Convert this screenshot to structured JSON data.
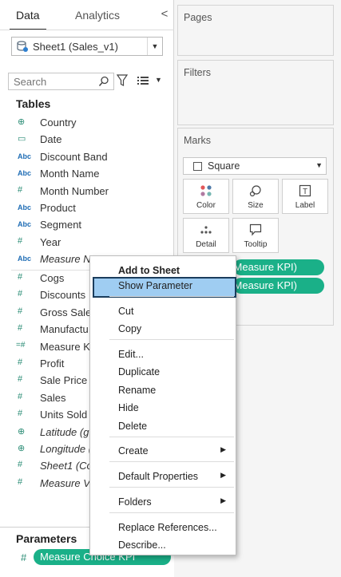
{
  "data_pane": {
    "tabs": [
      "Data",
      "Analytics"
    ],
    "collapse_glyph": "<",
    "datasource": {
      "label": "Sheet1 (Sales_v1)",
      "icon": "database-icon"
    },
    "search": {
      "placeholder": "Search"
    },
    "tables_header": "Tables",
    "dimensions": [
      {
        "name": "Country",
        "type": "geo",
        "italic": false
      },
      {
        "name": "Date",
        "type": "date",
        "italic": false
      },
      {
        "name": "Discount Band",
        "type": "abc",
        "italic": false
      },
      {
        "name": "Month Name",
        "type": "abc",
        "italic": false
      },
      {
        "name": "Month Number",
        "type": "number",
        "italic": false
      },
      {
        "name": "Product",
        "type": "abc",
        "italic": false
      },
      {
        "name": "Segment",
        "type": "abc",
        "italic": false
      },
      {
        "name": "Year",
        "type": "number",
        "italic": false
      },
      {
        "name": "Measure N",
        "type": "abc",
        "italic": true
      }
    ],
    "measures": [
      {
        "name": "Cogs",
        "type": "number",
        "italic": false
      },
      {
        "name": "Discounts",
        "type": "number",
        "italic": false
      },
      {
        "name": "Gross Sales",
        "type": "number",
        "italic": false
      },
      {
        "name": "Manufactu",
        "type": "number",
        "italic": false
      },
      {
        "name": "Measure KI",
        "type": "calc",
        "italic": false
      },
      {
        "name": "Profit",
        "type": "number",
        "italic": false
      },
      {
        "name": "Sale Price",
        "type": "number",
        "italic": false
      },
      {
        "name": "Sales",
        "type": "number",
        "italic": false
      },
      {
        "name": "Units Sold",
        "type": "number",
        "italic": false
      },
      {
        "name": "Latitude (g",
        "type": "geo",
        "italic": true
      },
      {
        "name": "Longitude (",
        "type": "geo",
        "italic": true
      },
      {
        "name": "Sheet1 (Co",
        "type": "number",
        "italic": true
      },
      {
        "name": "Measure V",
        "type": "number",
        "italic": true
      }
    ],
    "parameters_header": "Parameters",
    "parameter": {
      "label": "Measure Choice KPI"
    }
  },
  "shelves": {
    "pages": "Pages",
    "filters": "Filters",
    "marks": {
      "title": "Marks",
      "mark_type": "Square",
      "buttons": [
        "Color",
        "Size",
        "Label",
        "Detail",
        "Tooltip"
      ],
      "pills": [
        "Measure KPI)",
        "Measure KPI)"
      ]
    }
  },
  "context_menu": {
    "items": [
      {
        "label": "Add to Sheet",
        "bold": true,
        "highlighted": false,
        "submenu": false
      },
      {
        "label": "Show Parameter",
        "bold": false,
        "highlighted": true,
        "submenu": false
      },
      {
        "label": "Cut",
        "bold": false,
        "highlighted": false,
        "submenu": false
      },
      {
        "label": "Copy",
        "bold": false,
        "highlighted": false,
        "submenu": false
      },
      {
        "label": "Edit...",
        "bold": false,
        "highlighted": false,
        "submenu": false
      },
      {
        "label": "Duplicate",
        "bold": false,
        "highlighted": false,
        "submenu": false
      },
      {
        "label": "Rename",
        "bold": false,
        "highlighted": false,
        "submenu": false
      },
      {
        "label": "Hide",
        "bold": false,
        "highlighted": false,
        "submenu": false
      },
      {
        "label": "Delete",
        "bold": false,
        "highlighted": false,
        "submenu": false
      },
      {
        "label": "Create",
        "bold": false,
        "highlighted": false,
        "submenu": true
      },
      {
        "label": "Default Properties",
        "bold": false,
        "highlighted": false,
        "submenu": true
      },
      {
        "label": "Folders",
        "bold": false,
        "highlighted": false,
        "submenu": true
      },
      {
        "label": "Replace References...",
        "bold": false,
        "highlighted": false,
        "submenu": false
      },
      {
        "label": "Describe...",
        "bold": false,
        "highlighted": false,
        "submenu": false
      }
    ]
  },
  "colors": {
    "pill_green": "#1ab088",
    "menu_highlight": "#9fcdf2",
    "menu_highlight_border": "#1b3d5c",
    "dimension_icon_blue": "#1f6db5",
    "measure_icon_green": "#2a8c75"
  }
}
